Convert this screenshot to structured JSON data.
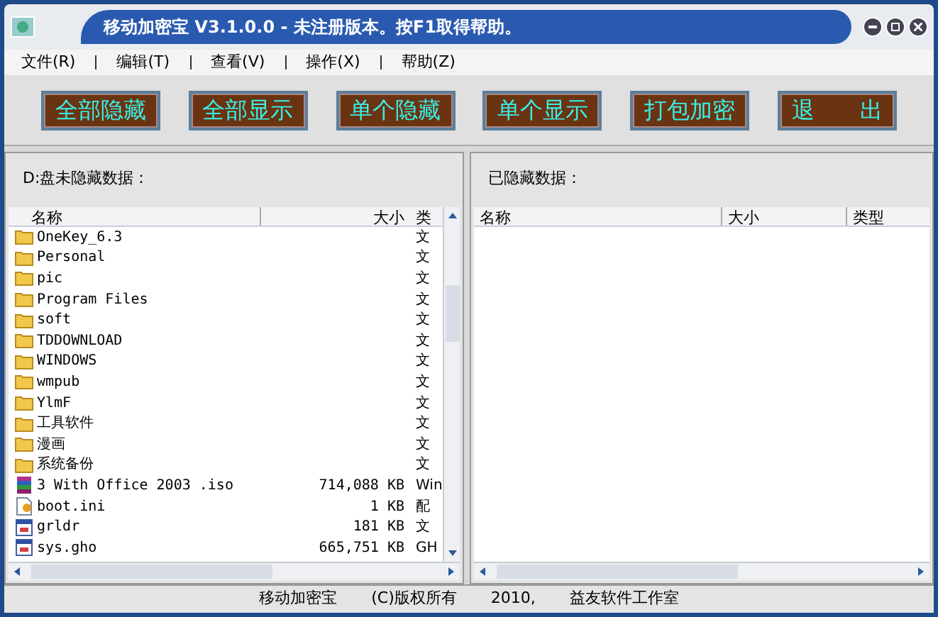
{
  "window": {
    "title": "移动加密宝  V3.1.0.0 - 未注册版本。按F1取得帮助。"
  },
  "menu": [
    "文件(R)",
    "编辑(T)",
    "查看(V)",
    "操作(X)",
    "帮助(Z)"
  ],
  "toolbar": [
    "全部隐藏",
    "全部显示",
    "单个隐藏",
    "单个显示",
    "打包加密",
    "退　　出"
  ],
  "left_panel": {
    "title": "D:盘未隐藏数据：",
    "columns": [
      "名称",
      "大小",
      "类"
    ],
    "rows": [
      {
        "kind": "folder",
        "name": "OneKey_6.3",
        "size": "",
        "type": "文"
      },
      {
        "kind": "folder",
        "name": "Personal",
        "size": "",
        "type": "文"
      },
      {
        "kind": "folder",
        "name": "pic",
        "size": "",
        "type": "文"
      },
      {
        "kind": "folder",
        "name": "Program Files",
        "size": "",
        "type": "文"
      },
      {
        "kind": "folder",
        "name": "soft",
        "size": "",
        "type": "文"
      },
      {
        "kind": "folder",
        "name": "TDDOWNLOAD",
        "size": "",
        "type": "文"
      },
      {
        "kind": "folder",
        "name": "WINDOWS",
        "size": "",
        "type": "文"
      },
      {
        "kind": "folder",
        "name": "wmpub",
        "size": "",
        "type": "文"
      },
      {
        "kind": "folder",
        "name": "YlmF",
        "size": "",
        "type": "文"
      },
      {
        "kind": "folder",
        "name": "工具软件",
        "size": "",
        "type": "文"
      },
      {
        "kind": "folder",
        "name": "漫画",
        "size": "",
        "type": "文"
      },
      {
        "kind": "folder",
        "name": "系统备份",
        "size": "",
        "type": "文"
      },
      {
        "kind": "archive",
        "name": "3 With Office 2003 .iso",
        "size": "714,088 KB",
        "type": "Win"
      },
      {
        "kind": "settings",
        "name": "boot.ini",
        "size": "1 KB",
        "type": "配"
      },
      {
        "kind": "program",
        "name": "grldr",
        "size": "181 KB",
        "type": "文"
      },
      {
        "kind": "program",
        "name": "sys.gho",
        "size": "665,751 KB",
        "type": "GH"
      }
    ]
  },
  "right_panel": {
    "title": "已隐藏数据：",
    "columns": [
      "名称",
      "大小",
      "类型"
    ]
  },
  "status_bar": [
    "移动加密宝",
    "(C)版权所有",
    "2010,",
    "益友软件工作室"
  ]
}
